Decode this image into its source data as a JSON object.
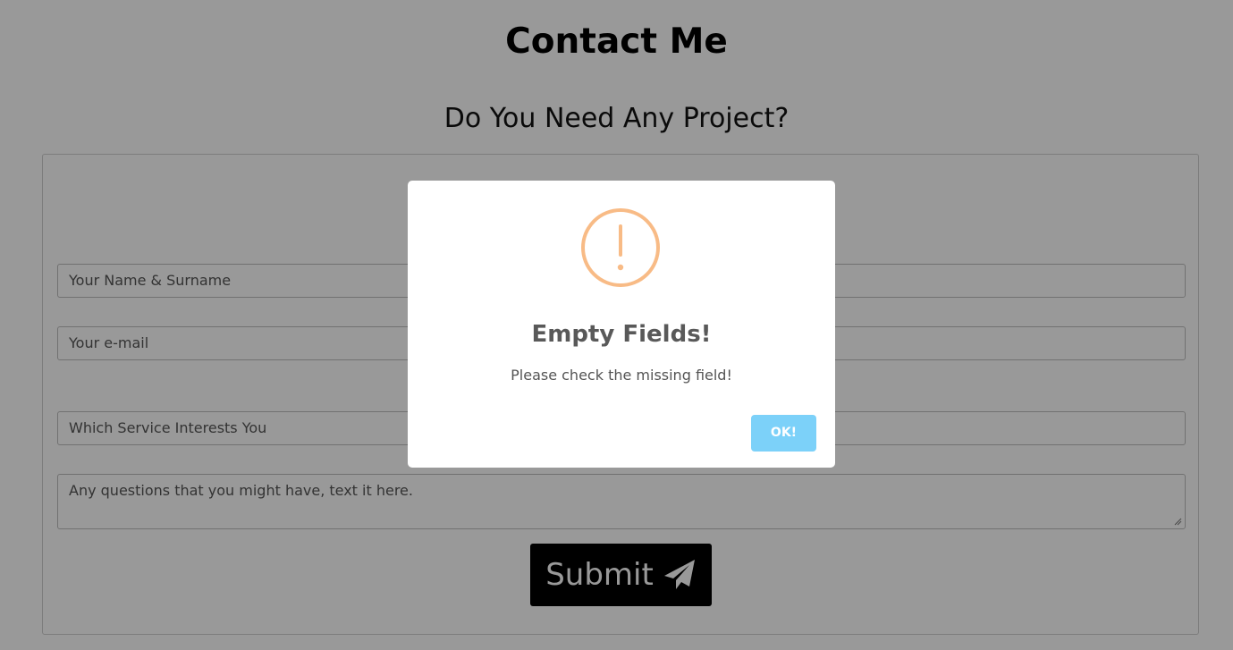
{
  "page": {
    "title": "Contact Me",
    "subtitle": "Do You Need Any Project?"
  },
  "form": {
    "name_placeholder": "Your Name & Surname",
    "email_placeholder": "Your e-mail",
    "service_placeholder": "Which Service Interests You",
    "message_placeholder": "Any questions that you might have, text it here.",
    "submit_label": "Submit",
    "submit_icon": "paper-plane-icon"
  },
  "alert": {
    "icon": "warning-icon",
    "title": "Empty Fields!",
    "text": "Please check the missing field!",
    "confirm_label": "OK!",
    "colors": {
      "icon": "#f8bb86",
      "confirm": "#7cd1f9",
      "overlay": "rgba(0,0,0,0.4)"
    }
  }
}
